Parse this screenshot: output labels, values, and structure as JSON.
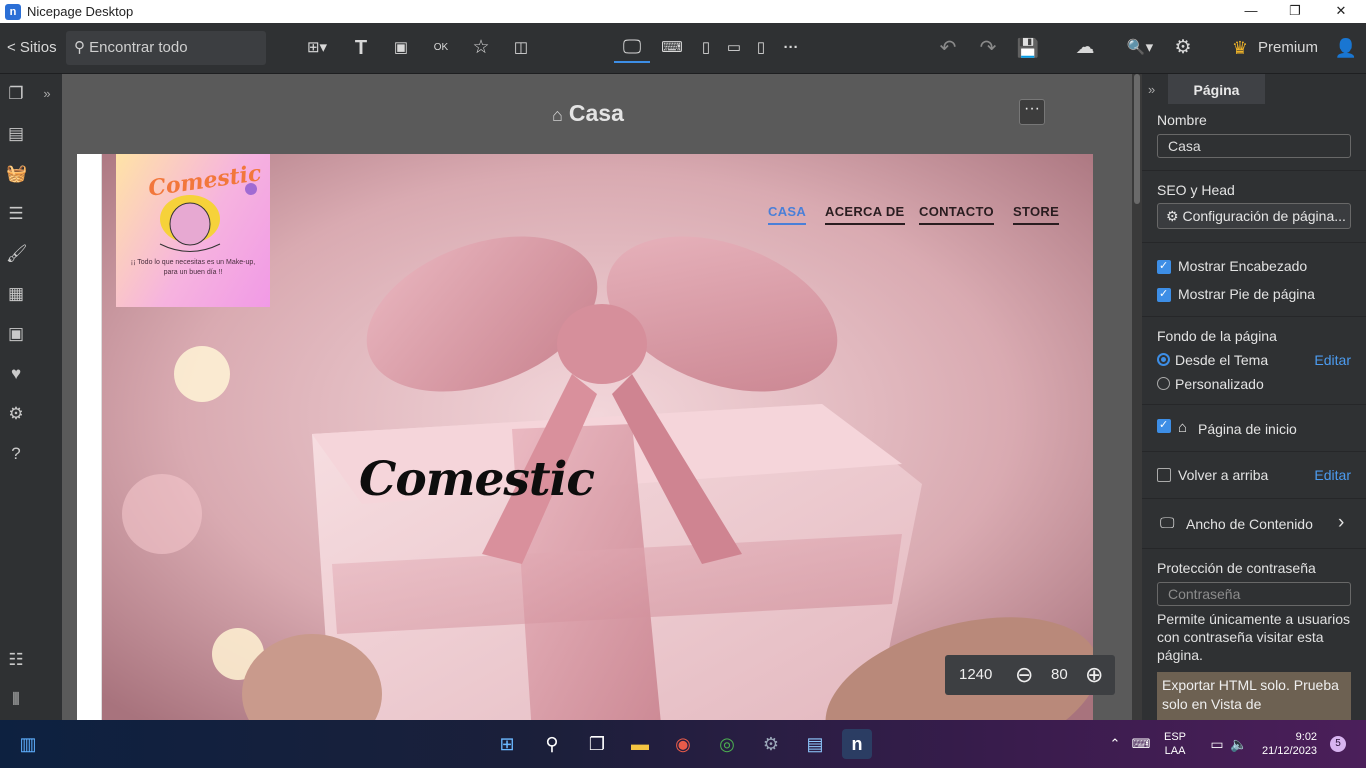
{
  "app": {
    "title": "Nicepage Desktop"
  },
  "toolbar": {
    "back_label": "< Sitios",
    "search_placeholder": "Encontrar todo",
    "premium_label": "Premium"
  },
  "canvas": {
    "page_title": "Casa",
    "width_value": "1240",
    "zoom_value": "80"
  },
  "site": {
    "logo_text": "Comestic",
    "logo_tagline": "¡¡ Todo lo que necesitas es un Make-up, para un buen día !!",
    "nav": [
      "CASA",
      "ACERCA DE",
      "CONTACTO",
      "STORE"
    ],
    "hero_heading": "Comestic"
  },
  "panel": {
    "tab_label": "Página",
    "name_label": "Nombre",
    "name_value": "Casa",
    "seo_label": "SEO y Head",
    "seo_button": "Configuración de página...",
    "show_header": "Mostrar Encabezado",
    "show_footer": "Mostrar Pie de página",
    "background_label": "Fondo de la página",
    "from_theme": "Desde el Tema",
    "custom": "Personalizado",
    "edit_label": "Editar",
    "home_page": "Página de inicio",
    "back_to_top": "Volver a arriba",
    "content_width": "Ancho de Contenido",
    "password_label": "Protección de contraseña",
    "password_placeholder": "Contraseña",
    "password_note": "Permite únicamente a usuarios con contraseña visitar esta página.",
    "export_note": "Exportar HTML solo. Prueba solo en Vista de"
  },
  "taskbar": {
    "lang_top": "ESP",
    "lang_bottom": "LAA",
    "time": "9:02",
    "date": "21/12/2023",
    "notifications": "5"
  }
}
